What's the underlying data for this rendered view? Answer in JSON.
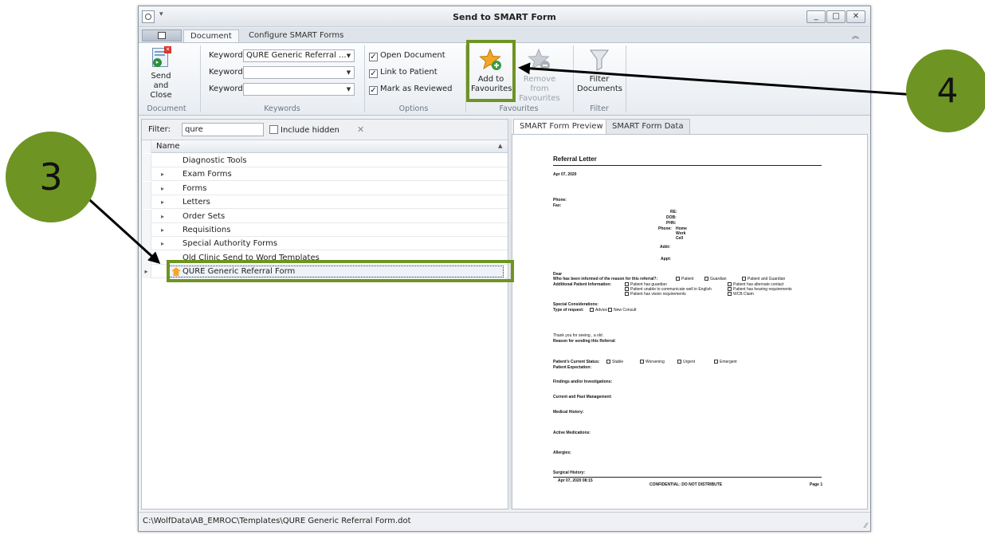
{
  "window": {
    "title": "Send to SMART Form",
    "controls": {
      "minimize": "_",
      "maximize": "□",
      "close": "✕"
    }
  },
  "ribbon_tabs": [
    {
      "label": "Document",
      "active": true
    },
    {
      "label": "Configure SMART Forms",
      "active": false
    }
  ],
  "ribbon": {
    "send_close": {
      "line1": "Send and",
      "line2": "Close"
    },
    "keywords": [
      {
        "label": "Keyword",
        "value": "QURE Generic Referral ..."
      },
      {
        "label": "Keyword",
        "value": ""
      },
      {
        "label": "Keyword",
        "value": ""
      }
    ],
    "options": [
      {
        "label": "Open Document",
        "checked": true
      },
      {
        "label": "Link to Patient",
        "checked": true
      },
      {
        "label": "Mark as Reviewed",
        "checked": true
      }
    ],
    "add_fav": {
      "line1": "Add to",
      "line2": "Favourites"
    },
    "remove_fav": {
      "line1": "Remove from",
      "line2": "Favourites"
    },
    "filter_docs": {
      "line1": "Filter",
      "line2": "Documents"
    },
    "groups": {
      "document": "Document",
      "keywords": "Keywords",
      "options": "Options",
      "favourites": "Favourites",
      "filter": "Filter"
    }
  },
  "filter": {
    "label": "Filter:",
    "value": "qure",
    "include_hidden": "Include hidden",
    "clear": "✕"
  },
  "grid": {
    "column": "Name",
    "rows": [
      {
        "name": "Diagnostic Tools",
        "expandable": false
      },
      {
        "name": "Exam Forms",
        "expandable": true
      },
      {
        "name": "Forms",
        "expandable": true
      },
      {
        "name": "Letters",
        "expandable": true
      },
      {
        "name": "Order Sets",
        "expandable": true
      },
      {
        "name": "Requisitions",
        "expandable": true
      },
      {
        "name": "Special Authority Forms",
        "expandable": true
      },
      {
        "name": "Old Clinic Send to Word Templates",
        "expandable": false
      },
      {
        "name": "QURE Generic Referral Form",
        "expandable": false,
        "selected": true
      }
    ]
  },
  "preview_tabs": [
    {
      "label": "SMART Form Preview",
      "active": true
    },
    {
      "label": "SMART Form Data",
      "active": false
    }
  ],
  "letter": {
    "title": "Referral Letter",
    "date": "Apr 07, 2020",
    "phone": "Phone:",
    "fax": "Fax:",
    "re": "RE:",
    "dob": "DOB:",
    "phn": "PHN:",
    "phone2": "Phone:",
    "home": "Home",
    "work": "Work",
    "cell": "Cell",
    "addr": "Addr:",
    "appt": "Appt:",
    "dear": "Dear",
    "informed": "Who has been informed of the reason for this referral?:",
    "informed_opts": [
      "Patient",
      "Guardian",
      "Patient and Guardian"
    ],
    "additional": "Additional Patient Information:",
    "additional_opts_left": [
      "Patient has guardian",
      "Patient unable to communicate well in English",
      "Patient has vision requirements"
    ],
    "additional_opts_right": [
      "Patient has alternate contact",
      "Patient has hearing requirements",
      "WCB Claim"
    ],
    "special": "Special Considerations:",
    "request": "Type of request:",
    "request_opts": [
      "Advice",
      "New Consult"
    ],
    "thanks": "Thank you for seeing , a old .",
    "reason": "Reason for sending this Referral:",
    "status": "Patient's Current Status:",
    "status_opts": [
      "Stable",
      "Worsening",
      "Urgent",
      "Emergent"
    ],
    "expectation": "Patient Expectation:",
    "findings": "Findings and/or Investigations:",
    "management": "Current and Past Management:",
    "medical": "Medical History:",
    "medications": "Active Medications:",
    "allergies": "Allergies:",
    "surgical": "Surgical History:",
    "footer_date": "Apr 07, 2020 08:15",
    "footer_conf": "CONFIDENTIAL: DO NOT DISTRIBUTE",
    "footer_page": "Page 1"
  },
  "status_bar": "C:\\WolfData\\AB_EMROC\\Templates\\QURE Generic Referral Form.dot",
  "annotations": {
    "step3": "3",
    "step4": "4"
  },
  "colors": {
    "highlight": "#6e9423",
    "fav_star": "#f5a623"
  }
}
